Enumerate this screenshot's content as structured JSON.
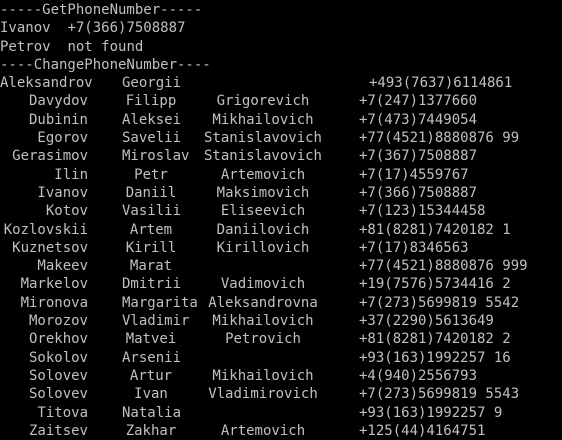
{
  "console": {
    "get_header": "-----GetPhoneNumber-----",
    "get_results": [
      {
        "surname": "Ivanov",
        "value": "+7(366)7508887"
      },
      {
        "surname": "Petrov",
        "value": "not found"
      }
    ],
    "change_header": "----ChangePhoneNumber----",
    "rows": [
      {
        "surname": "Aleksandrov",
        "name": "Georgii",
        "patronymic": "",
        "phone": "+493(7637)6114861"
      },
      {
        "surname": "Davydov",
        "name": "Filipp",
        "patronymic": "Grigorevich",
        "phone": "+7(247)1377660"
      },
      {
        "surname": "Dubinin",
        "name": "Aleksei",
        "patronymic": "Mikhailovich",
        "phone": "+7(473)7449054"
      },
      {
        "surname": "Egorov",
        "name": "Savelii",
        "patronymic": "Stanislavovich",
        "phone": "+77(4521)8880876 99"
      },
      {
        "surname": "Gerasimov",
        "name": "Miroslav",
        "patronymic": "Stanislavovich",
        "phone": "+7(367)7508887"
      },
      {
        "surname": "Ilin",
        "name": "Petr",
        "patronymic": "Artemovich",
        "phone": "+7(17)4559767"
      },
      {
        "surname": "Ivanov",
        "name": "Daniil",
        "patronymic": "Maksimovich",
        "phone": "+7(366)7508887"
      },
      {
        "surname": "Kotov",
        "name": "Vasilii",
        "patronymic": "Eliseevich",
        "phone": "+7(123)15344458"
      },
      {
        "surname": "Kozlovskii",
        "name": "Artem",
        "patronymic": "Daniilovich",
        "phone": "+81(8281)7420182 1"
      },
      {
        "surname": "Kuznetsov",
        "name": "Kirill",
        "patronymic": "Kirillovich",
        "phone": "+7(17)8346563"
      },
      {
        "surname": "Makeev",
        "name": "Marat",
        "patronymic": "",
        "phone": "+77(4521)8880876 999"
      },
      {
        "surname": "Markelov",
        "name": "Dmitrii",
        "patronymic": "Vadimovich",
        "phone": "+19(7576)5734416 2"
      },
      {
        "surname": "Mironova",
        "name": "Margarita",
        "patronymic": "Aleksandrovna",
        "phone": "+7(273)5699819 5542"
      },
      {
        "surname": "Morozov",
        "name": "Vladimir",
        "patronymic": "Mikhailovich",
        "phone": "+37(2290)5613649"
      },
      {
        "surname": "Orekhov",
        "name": "Matvei",
        "patronymic": "Petrovich",
        "phone": "+81(8281)7420182 2"
      },
      {
        "surname": "Sokolov",
        "name": "Arsenii",
        "patronymic": "",
        "phone": "+93(163)1992257 16"
      },
      {
        "surname": "Solovev",
        "name": "Artur",
        "patronymic": "Mikhailovich",
        "phone": "+4(940)2556793"
      },
      {
        "surname": "Solovev",
        "name": "Ivan",
        "patronymic": "Vladimirovich",
        "phone": "+7(273)5699819 5543"
      },
      {
        "surname": "Titova",
        "name": "Natalia",
        "patronymic": "",
        "phone": "+93(163)1992257 9"
      },
      {
        "surname": "Zaitsev",
        "name": "Zakhar",
        "patronymic": "Artemovich",
        "phone": "+125(44)4164751"
      }
    ]
  },
  "colors": {
    "background": "#000000",
    "text": "#c0c0c0"
  }
}
